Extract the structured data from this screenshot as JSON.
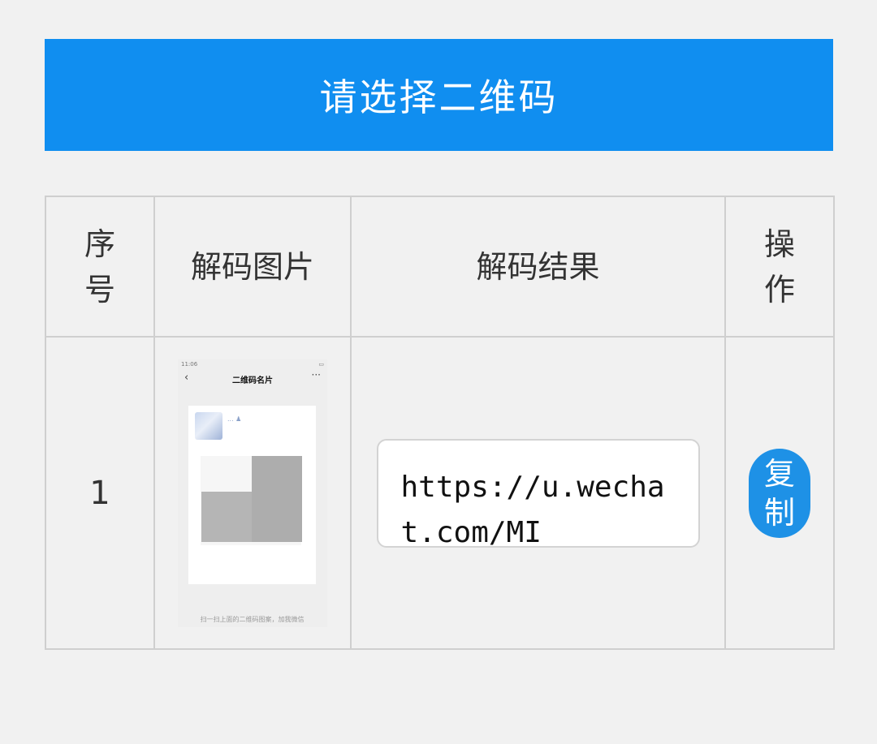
{
  "select_button": {
    "label": "请选择二维码"
  },
  "table": {
    "headers": {
      "index": "序号",
      "image": "解码图片",
      "result": "解码结果",
      "action": "操作"
    },
    "rows": [
      {
        "index": "1",
        "thumbnail": {
          "status_time": "11:06",
          "title": "二维码名片",
          "back_icon": "chevron-left-icon",
          "more_icon": "more-dots-icon",
          "name": "... ♟",
          "caption": "扫一扫上面的二维码图案，加我微信"
        },
        "result": "https://u.wechat.com/MI",
        "action_label": "复制"
      }
    ]
  },
  "colors": {
    "primary": "#108ef0",
    "copy_button": "#1e91e6",
    "background": "#f1f1f1",
    "border": "#cfcfcf"
  }
}
